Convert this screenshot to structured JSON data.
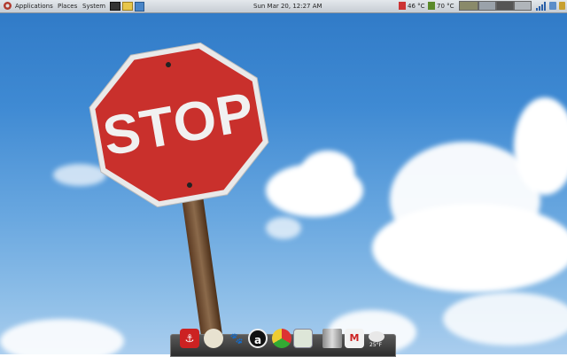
{
  "panel": {
    "menus": [
      "Applications",
      "Places",
      "System"
    ],
    "clock": "Sun Mar 20, 12:27 AM",
    "temp_cpu": "46 °C",
    "temp_gpu": "70 °C"
  },
  "wallpaper": {
    "sign_text": "STOP"
  },
  "dock": {
    "weather_temp": "25°F"
  },
  "colors": {
    "sky": "#3f8ad3",
    "sign_red": "#c9302c",
    "panel": "#d6dbe0"
  }
}
